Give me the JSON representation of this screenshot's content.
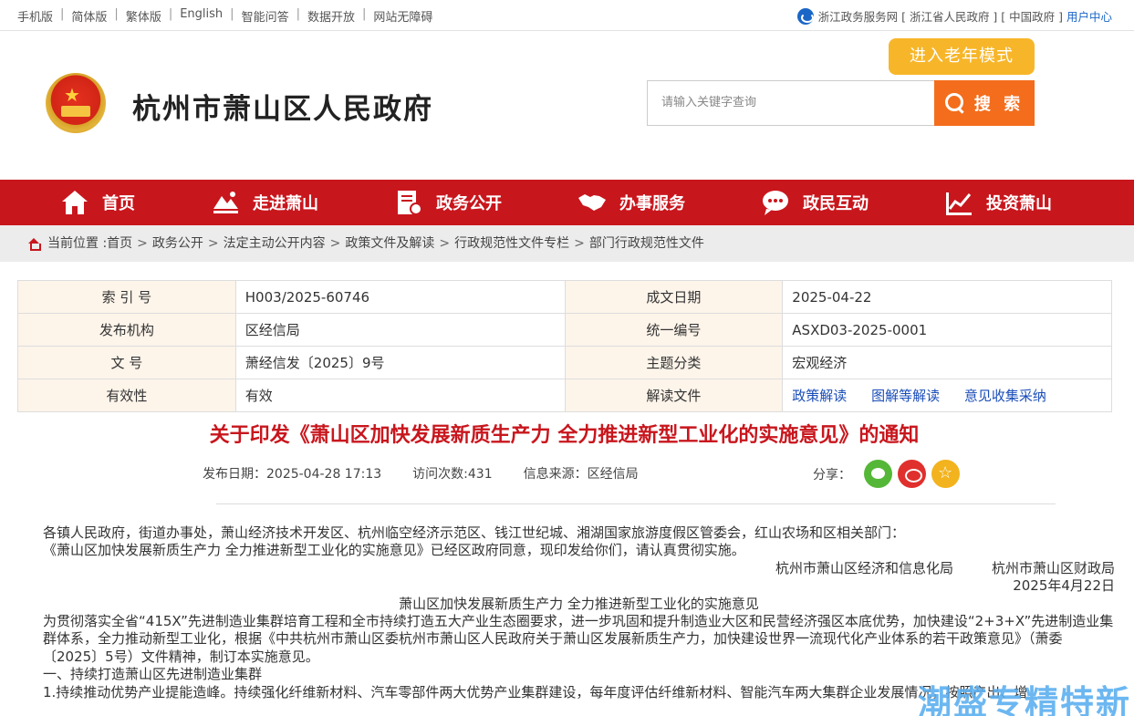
{
  "topbar": {
    "links": [
      "手机版",
      "简体版",
      "繁体版",
      "English",
      "智能问答",
      "数据开放",
      "网站无障碍"
    ],
    "right_text": "浙江政务服务网 [ 浙江省人民政府 ] [ 中国政府 ]",
    "user_center": "用户中心"
  },
  "header": {
    "site_title": "杭州市萧山区人民政府",
    "elder_mode": "进入老年模式",
    "search_placeholder": "请输入关键字查询",
    "search_button": "搜 索"
  },
  "nav": {
    "items": [
      {
        "label": "首页",
        "icon": "home-icon"
      },
      {
        "label": "走进萧山",
        "icon": "landscape-icon"
      },
      {
        "label": "政务公开",
        "icon": "document-icon"
      },
      {
        "label": "办事服务",
        "icon": "handshake-icon"
      },
      {
        "label": "政民互动",
        "icon": "chat-icon"
      },
      {
        "label": "投资萧山",
        "icon": "chart-icon"
      }
    ]
  },
  "breadcrumb": {
    "prefix": "当前位置 :",
    "items": [
      "首页",
      "政务公开",
      "法定主动公开内容",
      "政策文件及解读",
      "行政规范性文件专栏",
      "部门行政规范性文件"
    ]
  },
  "meta": {
    "rows": [
      [
        {
          "k": "索 引 号",
          "v": "H003/2025-60746"
        },
        {
          "k": "成文日期",
          "v": "2025-04-22"
        }
      ],
      [
        {
          "k": "发布机构",
          "v": "区经信局"
        },
        {
          "k": "统一编号",
          "v": "ASXD03-2025-0001"
        }
      ],
      [
        {
          "k": "文 号",
          "v": "萧经信发〔2025〕9号"
        },
        {
          "k": "主题分类",
          "v": "宏观经济"
        }
      ],
      [
        {
          "k": "有效性",
          "v": "有效"
        },
        {
          "k": "解读文件",
          "links": [
            "政策解读",
            "图解等解读",
            "意见收集采纳"
          ]
        }
      ]
    ]
  },
  "article": {
    "title": "关于印发《萧山区加快发展新质生产力 全力推进新型工业化的实施意见》的通知",
    "publish_date": "发布日期：2025-04-28 17:13",
    "visits": "访问次数:431",
    "source": "信息来源：区经信局",
    "share_label": "分享：",
    "paragraphs": {
      "p1": "各镇人民政府，街道办事处，萧山经济技术开发区、杭州临空经济示范区、钱江世纪城、湘湖国家旅游度假区管委会，红山农场和区相关部门：",
      "p2": "《萧山区加快发展新质生产力 全力推进新型工业化的实施意见》已经区政府同意，现印发给你们，请认真贯彻实施。",
      "sign1": "杭州市萧山区经济和信息化局",
      "sign2": "杭州市萧山区财政局",
      "date": "2025年4月22日",
      "subtitle": "萧山区加快发展新质生产力 全力推进新型工业化的实施意见",
      "p3": "为贯彻落实全省“415X”先进制造业集群培育工程和全市持续打造五大产业生态圈要求，进一步巩固和提升制造业大区和民营经济强区本底优势，加快建设“2+3+X”先进制造业集群体系，全力推动新型工业化，根据《中共杭州市萧山区委杭州市萧山区人民政府关于萧山区发展新质生产力，加快建设世界一流现代化产业体系的若干政策意见》（萧委〔2025〕5号）文件精神，制订本实施意见。",
      "h1": "一、持续打造萧山区先进制造业集群",
      "p4": "1.持续推动优势产业提能造峰。持续强化纤维新材料、汽车零部件两大优势产业集群建设，每年度评估纤维新材料、智能汽车两大集群企业发展情况，按照产出、增"
    }
  },
  "watermark": "潮盛专精特新"
}
